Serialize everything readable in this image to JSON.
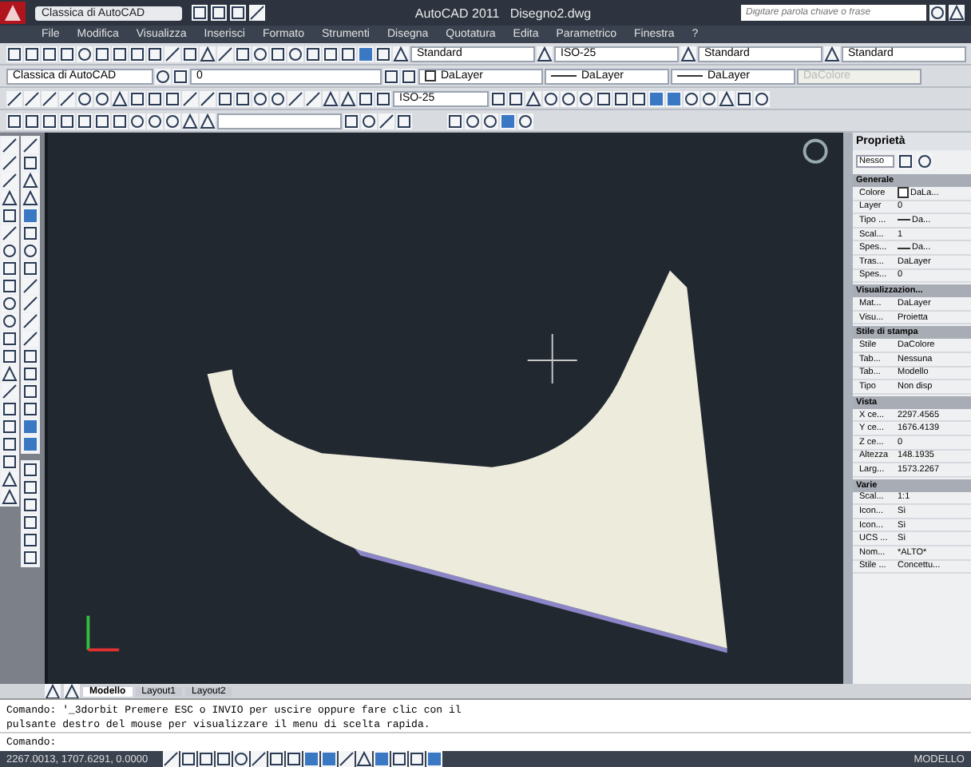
{
  "title_bar": {
    "workspace": "Classica di AutoCAD",
    "app": "AutoCAD 2011",
    "file": "Disegno2.dwg",
    "search": {
      "placeholder": "Digitare parola chiave o frase"
    }
  },
  "menu": [
    "File",
    "Modifica",
    "Visualizza",
    "Inserisci",
    "Formato",
    "Strumenti",
    "Disegna",
    "Quotatura",
    "Edita",
    "Parametrico",
    "Finestra",
    "?"
  ],
  "style_toolbar": [
    {
      "value": "Standard"
    },
    {
      "value": "ISO-25"
    },
    {
      "value": "Standard"
    },
    {
      "value": "Standard"
    }
  ],
  "layers_toolbar": {
    "workspace": "Classica di AutoCAD",
    "layer": "0"
  },
  "properties_toolbar": [
    {
      "kind": "color",
      "value": "DaLayer",
      "disabled": false
    },
    {
      "kind": "linetype",
      "value": "DaLayer",
      "disabled": false
    },
    {
      "kind": "linetype",
      "value": "DaLayer",
      "disabled": false
    },
    {
      "kind": "text",
      "value": "DaColore",
      "disabled": true
    }
  ],
  "dimension_toolbar": {
    "style": "ISO-25"
  },
  "properties_palette": {
    "title": "Proprietà",
    "selection": "Nesso",
    "sections": [
      {
        "title": "Generale",
        "rows": [
          {
            "label": "Colore",
            "value": "DaLa...",
            "kind": "color"
          },
          {
            "label": "Layer",
            "value": "0",
            "kind": "text"
          },
          {
            "label": "Tipo ...",
            "value": "Da...",
            "kind": "linetype"
          },
          {
            "label": "Scal...",
            "value": "1",
            "kind": "text"
          },
          {
            "label": "Spes...",
            "value": "Da...",
            "kind": "linetype"
          },
          {
            "label": "Tras...",
            "value": "DaLayer",
            "kind": "text"
          },
          {
            "label": "Spes...",
            "value": "0",
            "kind": "text"
          }
        ]
      },
      {
        "title": "Visualizzazion...",
        "rows": [
          {
            "label": "Mat...",
            "value": "DaLayer",
            "kind": "text"
          },
          {
            "label": "Visu...",
            "value": "Proietta",
            "kind": "text"
          }
        ]
      },
      {
        "title": "Stile di stampa",
        "rows": [
          {
            "label": "Stile",
            "value": "DaColore",
            "kind": "text"
          },
          {
            "label": "Tab...",
            "value": "Nessuna",
            "kind": "text"
          },
          {
            "label": "Tab...",
            "value": "Modello",
            "kind": "text"
          },
          {
            "label": "Tipo",
            "value": "Non disp",
            "kind": "text"
          }
        ]
      },
      {
        "title": "Vista",
        "rows": [
          {
            "label": "X ce...",
            "value": "2297.4565",
            "kind": "text"
          },
          {
            "label": "Y ce...",
            "value": "1676.4139",
            "kind": "text"
          },
          {
            "label": "Z ce...",
            "value": "0",
            "kind": "text"
          },
          {
            "label": "Altezza",
            "value": "148.1935",
            "kind": "text"
          },
          {
            "label": "Larg...",
            "value": "1573.2267",
            "kind": "text"
          }
        ]
      },
      {
        "title": "Varie",
        "rows": [
          {
            "label": "Scal...",
            "value": "1:1",
            "kind": "text"
          },
          {
            "label": "Icon...",
            "value": "Sì",
            "kind": "text"
          },
          {
            "label": "Icon...",
            "value": "Sì",
            "kind": "text"
          },
          {
            "label": "UCS ...",
            "value": "Sì",
            "kind": "text"
          },
          {
            "label": "Nom...",
            "value": "*ALTO*",
            "kind": "text"
          },
          {
            "label": "Stile ...",
            "value": "Concettu...",
            "kind": "text"
          }
        ]
      }
    ]
  },
  "layout_tabs": [
    {
      "label": "Modello",
      "selected": true
    },
    {
      "label": "Layout1",
      "selected": false
    },
    {
      "label": "Layout2",
      "selected": false
    }
  ],
  "command_history": [
    "Comando: '_3dorbit Premere ESC o INVIO per uscire oppure fare clic con il",
    "pulsante destro del mouse per visualizzare il menu di scelta rapida."
  ],
  "command_prompt": "Comando:",
  "status_bar": {
    "coordinates": "2267.0013, 1707.6291, 0.0000",
    "space": "MODELLO"
  }
}
